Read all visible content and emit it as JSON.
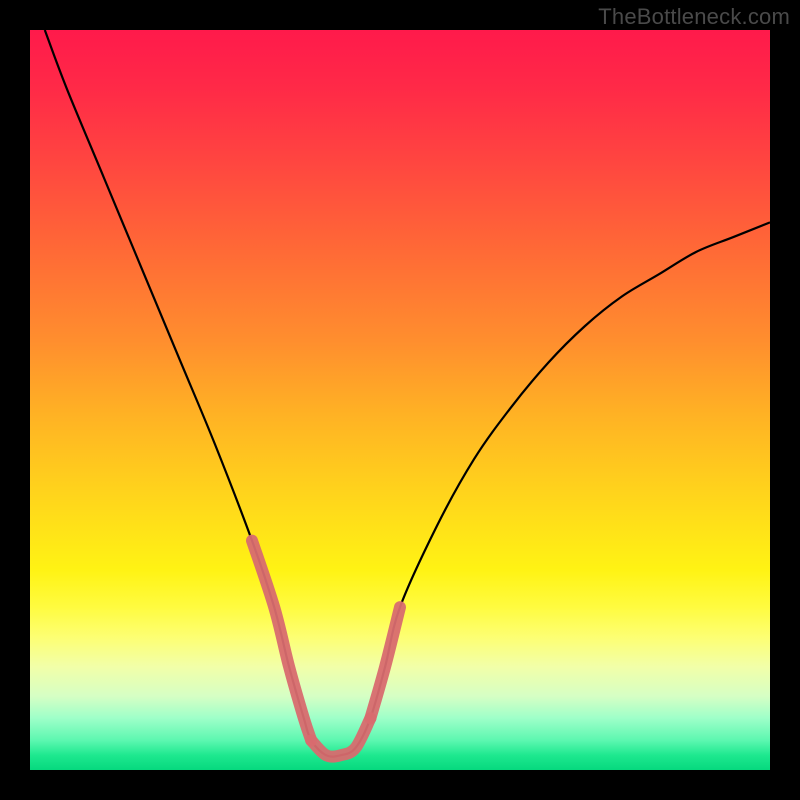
{
  "watermark": "TheBottleneck.com",
  "colors": {
    "background": "#000000",
    "curve": "#000000",
    "highlight": "#d86b6f"
  },
  "chart_data": {
    "type": "line",
    "title": "",
    "xlabel": "",
    "ylabel": "",
    "xlim": [
      0,
      100
    ],
    "ylim": [
      0,
      100
    ],
    "grid": false,
    "series": [
      {
        "name": "bottleneck-curve",
        "x": [
          2,
          5,
          10,
          15,
          20,
          25,
          30,
          33,
          35,
          37,
          38,
          40,
          42,
          44,
          46,
          48,
          50,
          55,
          60,
          65,
          70,
          75,
          80,
          85,
          90,
          95,
          100
        ],
        "y": [
          100,
          92,
          80,
          68,
          56,
          44,
          31,
          22,
          14,
          7,
          4,
          2,
          2,
          3,
          7,
          14,
          22,
          33,
          42,
          49,
          55,
          60,
          64,
          67,
          70,
          72,
          74
        ]
      }
    ],
    "highlight_segments": [
      {
        "x": [
          30,
          33,
          35,
          37,
          38
        ],
        "y": [
          31,
          22,
          14,
          7,
          4
        ]
      },
      {
        "x": [
          38,
          40,
          42,
          44,
          46
        ],
        "y": [
          4,
          2,
          2,
          3,
          7
        ]
      },
      {
        "x": [
          46,
          48,
          50
        ],
        "y": [
          7,
          14,
          22
        ]
      }
    ],
    "note": "Axes have no visible tick labels; x and y are normalized 0–100 spanning the plot area. Values estimated from pixel positions."
  }
}
